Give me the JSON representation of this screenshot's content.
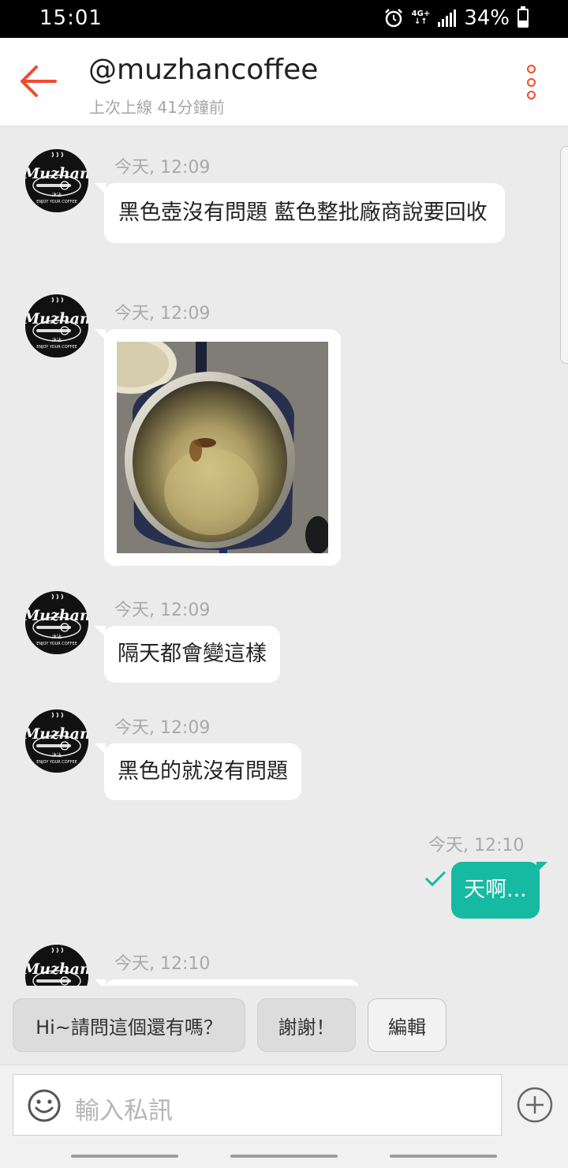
{
  "status_bar": {
    "time": "15:01",
    "network": "4G+",
    "battery": "34%",
    "battery_level": 0.34,
    "icons": [
      "alarm-icon",
      "network-4g-icon",
      "signal-icon",
      "battery-icon"
    ]
  },
  "header": {
    "title": "@muzhancoffee",
    "subtitle": "上次上線 41分鐘前",
    "back_icon": "back-arrow-icon",
    "menu_icon": "more-vertical-icon"
  },
  "avatar": {
    "logo_text": "Muzhan",
    "logo_sub": "沐沾",
    "logo_tagline": "ENJOY YOUR COFFEE"
  },
  "messages": [
    {
      "direction": "in",
      "time": "今天, 12:09",
      "type": "text",
      "text": "黑色壺沒有問題 藍色整批廠商說要回收"
    },
    {
      "direction": "in",
      "time": "今天, 12:09",
      "type": "image",
      "image_desc": "photo"
    },
    {
      "direction": "in",
      "time": "今天, 12:09",
      "type": "text",
      "text": "隔天都會變這樣"
    },
    {
      "direction": "in",
      "time": "今天, 12:09",
      "type": "text",
      "text": "黑色的就沒有問題"
    },
    {
      "direction": "out",
      "time": "今天, 12:10",
      "type": "text",
      "text": "天啊...",
      "status": "sent-check-icon"
    },
    {
      "direction": "in",
      "time": "今天, 12:10",
      "type": "text",
      "text": ""
    }
  ],
  "quick_replies": [
    "Hi~請問這個還有嗎？",
    "謝謝！",
    "編輯"
  ],
  "input": {
    "placeholder": "輸入私訊",
    "emoji_icon": "smiley-icon",
    "add_icon": "plus-circle-icon"
  },
  "colors": {
    "accent": "#ee4d2d",
    "outgoing_bubble": "#16b9a1",
    "background": "#ebebeb"
  }
}
